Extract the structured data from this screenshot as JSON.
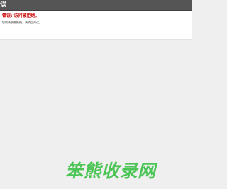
{
  "window": {
    "title": "误"
  },
  "error": {
    "heading": "错误: 访问被拒绝。",
    "detail": "您的请求被拒绝，请稍后再试。"
  },
  "watermark": {
    "text": "笨熊收录网",
    "color": "#3fc24a"
  },
  "colors": {
    "titlebar": "#555555",
    "page_background": "#efefef",
    "content_background": "#ffffff",
    "error_text": "#cc0000"
  }
}
